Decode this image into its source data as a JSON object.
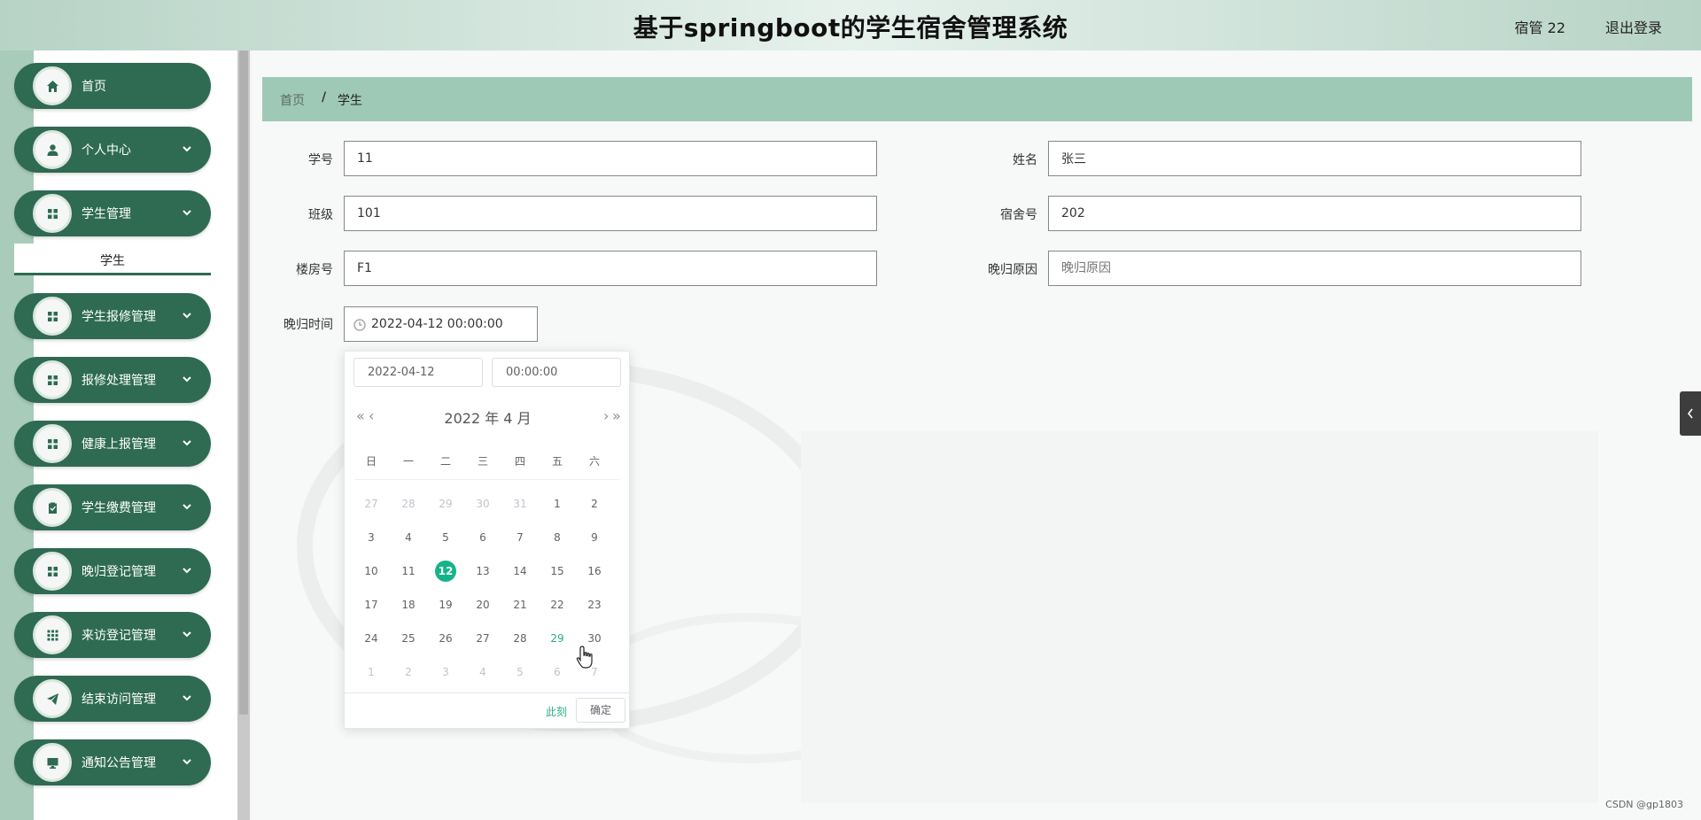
{
  "header": {
    "title": "基于springboot的学生宿舍管理系统",
    "user": "宿管 22",
    "logout": "退出登录"
  },
  "sidebar": {
    "items": [
      {
        "label": "首页",
        "icon": "home-icon",
        "has_chevron": false
      },
      {
        "label": "个人中心",
        "icon": "person-icon",
        "has_chevron": true
      },
      {
        "label": "学生管理",
        "icon": "grid-icon",
        "has_chevron": true
      },
      {
        "label": "学生报修管理",
        "icon": "grid-icon",
        "has_chevron": true
      },
      {
        "label": "报修处理管理",
        "icon": "grid-icon",
        "has_chevron": true
      },
      {
        "label": "健康上报管理",
        "icon": "grid-icon",
        "has_chevron": true
      },
      {
        "label": "学生缴费管理",
        "icon": "clipboard-icon",
        "has_chevron": true
      },
      {
        "label": "晚归登记管理",
        "icon": "grid-icon",
        "has_chevron": true
      },
      {
        "label": "来访登记管理",
        "icon": "apps-icon",
        "has_chevron": true
      },
      {
        "label": "结束访问管理",
        "icon": "send-icon",
        "has_chevron": true
      },
      {
        "label": "通知公告管理",
        "icon": "monitor-icon",
        "has_chevron": true
      }
    ],
    "submenu": {
      "label": "学生"
    }
  },
  "breadcrumb": {
    "home": "首页",
    "separator": "/",
    "current": "学生"
  },
  "form": {
    "student_no": {
      "label": "学号",
      "value": "11"
    },
    "name": {
      "label": "姓名",
      "value": "张三"
    },
    "class": {
      "label": "班级",
      "value": "101"
    },
    "dorm_no": {
      "label": "宿舍号",
      "value": "202"
    },
    "building_no": {
      "label": "楼房号",
      "value": "F1"
    },
    "late_reason": {
      "label": "晚归原因",
      "value": "",
      "placeholder": "晚归原因"
    },
    "late_time": {
      "label": "晚归时间",
      "value": "2022-04-12 00:00:00"
    }
  },
  "datepicker": {
    "date_value": "2022-04-12",
    "time_value": "00:00:00",
    "title": "2022 年  4 月",
    "prev_year": "«",
    "prev_month": "‹",
    "next_month": "›",
    "next_year": "»",
    "weekdays": [
      "日",
      "一",
      "二",
      "三",
      "四",
      "五",
      "六"
    ],
    "weeks": [
      [
        {
          "d": "27",
          "t": "other"
        },
        {
          "d": "28",
          "t": "other"
        },
        {
          "d": "29",
          "t": "other"
        },
        {
          "d": "30",
          "t": "other"
        },
        {
          "d": "31",
          "t": "other"
        },
        {
          "d": "1",
          "t": "cur"
        },
        {
          "d": "2",
          "t": "cur"
        }
      ],
      [
        {
          "d": "3",
          "t": "cur"
        },
        {
          "d": "4",
          "t": "cur"
        },
        {
          "d": "5",
          "t": "cur"
        },
        {
          "d": "6",
          "t": "cur"
        },
        {
          "d": "7",
          "t": "cur"
        },
        {
          "d": "8",
          "t": "cur"
        },
        {
          "d": "9",
          "t": "cur"
        }
      ],
      [
        {
          "d": "10",
          "t": "cur"
        },
        {
          "d": "11",
          "t": "cur"
        },
        {
          "d": "12",
          "t": "sel"
        },
        {
          "d": "13",
          "t": "cur"
        },
        {
          "d": "14",
          "t": "cur"
        },
        {
          "d": "15",
          "t": "cur"
        },
        {
          "d": "16",
          "t": "cur"
        }
      ],
      [
        {
          "d": "17",
          "t": "cur"
        },
        {
          "d": "18",
          "t": "cur"
        },
        {
          "d": "19",
          "t": "cur"
        },
        {
          "d": "20",
          "t": "cur"
        },
        {
          "d": "21",
          "t": "cur"
        },
        {
          "d": "22",
          "t": "cur"
        },
        {
          "d": "23",
          "t": "cur"
        }
      ],
      [
        {
          "d": "24",
          "t": "cur"
        },
        {
          "d": "25",
          "t": "cur"
        },
        {
          "d": "26",
          "t": "cur"
        },
        {
          "d": "27",
          "t": "cur"
        },
        {
          "d": "28",
          "t": "cur"
        },
        {
          "d": "29",
          "t": "today"
        },
        {
          "d": "30",
          "t": "cur"
        }
      ],
      [
        {
          "d": "1",
          "t": "other"
        },
        {
          "d": "2",
          "t": "other"
        },
        {
          "d": "3",
          "t": "other"
        },
        {
          "d": "4",
          "t": "other"
        },
        {
          "d": "5",
          "t": "other"
        },
        {
          "d": "6",
          "t": "other"
        },
        {
          "d": "7",
          "t": "other"
        }
      ]
    ],
    "now_label": "此刻",
    "ok_label": "确定"
  },
  "credit": "CSDN @gp1803",
  "colors": {
    "sidebar_item": "#2e6b52",
    "breadcrumb_bg": "#9ec9b6",
    "accent": "#14b48a"
  }
}
